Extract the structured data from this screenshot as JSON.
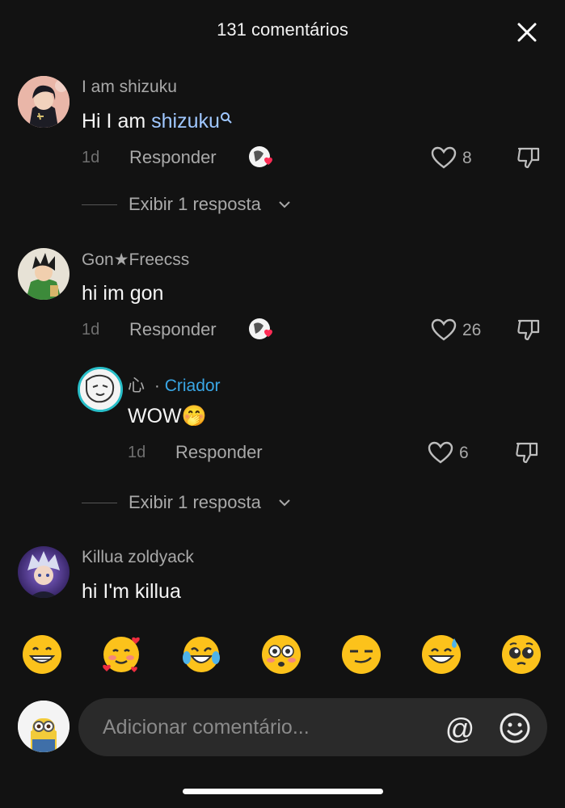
{
  "header": {
    "title": "131 comentários"
  },
  "comments": [
    {
      "username": "I am shizuku",
      "text_prefix": "Hi I am ",
      "mention": "shizuku",
      "time": "1d",
      "reply_label": "Responder",
      "likes": "8",
      "view_replies": "Exibir 1 resposta"
    },
    {
      "username": "Gon★Freecss",
      "text": "hi im gon",
      "time": "1d",
      "reply_label": "Responder",
      "likes": "26",
      "reply": {
        "username": "心",
        "separator": "·",
        "badge": "Criador",
        "text": "WOW🤭",
        "time": "1d",
        "reply_label": "Responder",
        "likes": "6"
      },
      "view_replies": "Exibir 1 resposta"
    },
    {
      "username": "Killua zoldyack",
      "text": "hi I'm killua"
    }
  ],
  "quick_emojis": [
    "😁",
    "🥰",
    "😂",
    "😳",
    "😏",
    "😅",
    "🥺"
  ],
  "composer": {
    "placeholder": "Adicionar comentário...",
    "mention_symbol": "@"
  },
  "colors": {
    "background": "#121212",
    "mention": "#9fc7ff",
    "creator_badge": "#3aa7e6",
    "input_bg": "#2a2a2a"
  }
}
